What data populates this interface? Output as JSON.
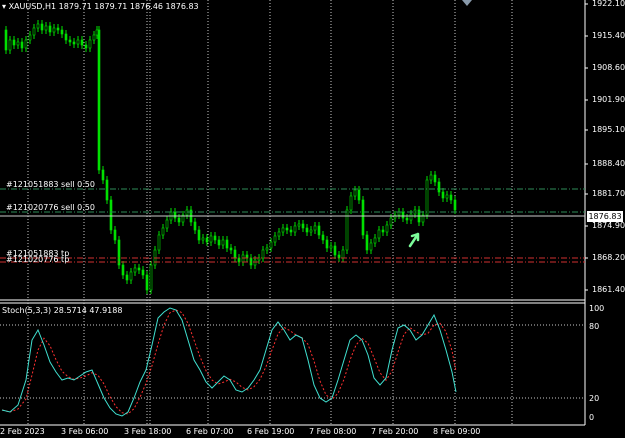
{
  "header": {
    "symbol_tf": "XAUUSD,H1",
    "ohlc": "1879.71 1879.71 1876.46 1876.83"
  },
  "price_axis": {
    "ticks": [
      "1922.10",
      "1915.40",
      "1908.60",
      "1901.90",
      "1895.10",
      "1888.40",
      "1881.70",
      "1874.90",
      "1868.20",
      "1861.40"
    ],
    "current_price": "1876.83"
  },
  "orders": [
    {
      "label": "#121051883 sell 0.50",
      "type": "sell"
    },
    {
      "label": "#121020776 sell 0.50",
      "type": "sell"
    },
    {
      "label": "#121051883 tp",
      "type": "tp"
    },
    {
      "label": "#121020776 tp",
      "type": "tp"
    }
  ],
  "stoch": {
    "title": "Stoch(5,3,3) 28.5714 47.9188",
    "ticks": [
      "100",
      "80",
      "20",
      "0"
    ],
    "main_color": "#40e0d0",
    "signal_color": "#ff3030"
  },
  "time_axis": {
    "labels": [
      "2 Feb 2023",
      "3 Feb 06:00",
      "3 Feb 18:00",
      "6 Feb 07:00",
      "6 Feb 19:00",
      "7 Feb 08:00",
      "7 Feb 20:00",
      "8 Feb 09:00"
    ]
  },
  "colors": {
    "bull": "#00e000",
    "bear": "#00e000",
    "order_line": "#2e8b57",
    "tp_line": "#d03030",
    "arrow": "#7cfc9a"
  }
}
